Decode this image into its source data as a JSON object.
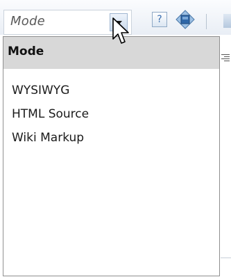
{
  "mode_select": {
    "value": "Mode",
    "dropdown_icon": "dropdown-arrow-icon"
  },
  "toolbar": {
    "help_icon": "help-icon",
    "help_label": "?",
    "component_icon": "component-icon"
  },
  "dropdown": {
    "header": "Mode",
    "options": [
      "WYSIWYG",
      "HTML Source",
      "Wiki Markup"
    ]
  },
  "colors": {
    "header_bg": "#d8d8d8",
    "accent": "#3c6fb0",
    "border": "#8f8f8f"
  }
}
